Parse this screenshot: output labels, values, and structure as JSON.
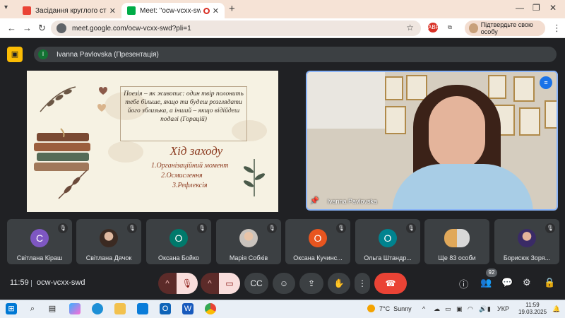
{
  "browser": {
    "tabs": [
      {
        "title": "Засідання круглого столу з ел",
        "active": false
      },
      {
        "title": "Meet: \"ocw-vcxx-swd\"",
        "active": true
      }
    ],
    "new_tab": "+",
    "url": "meet.google.com/ocw-vcxx-swd?pli=1",
    "confirm_label": "Підтвердьте свою особу",
    "ext_label": "ABP"
  },
  "meet": {
    "presenter_initial": "I",
    "presentation_label": "Ivanna Pavlovska (Презентація)",
    "slide": {
      "quote": "Поезія – як живопис: один твір полонить тебе більше, якщо ти будеш розглядати його зблизька, а інший – якщо відійдеш подалі (Горацій)",
      "title": "Хід заходу",
      "items": [
        "1.Організаційний момент",
        "2.Осмислення",
        "3.Рефлексія"
      ]
    },
    "main_video_name": "Ivanna Pavlovska",
    "participants": [
      {
        "name": "Світлана Кіраш",
        "initial": "С",
        "color": "#7e57c2",
        "photo": false
      },
      {
        "name": "Світлана Дячок",
        "initial": "",
        "color": "#8d5a44",
        "photo": true
      },
      {
        "name": "Оксана Бойко",
        "initial": "О",
        "color": "#00796b",
        "photo": false
      },
      {
        "name": "Марія Собків",
        "initial": "",
        "color": "#b0a29a",
        "photo": true
      },
      {
        "name": "Оксана Кучинс...",
        "initial": "О",
        "color": "#e8551f",
        "photo": false
      },
      {
        "name": "Ольга Штандр...",
        "initial": "О",
        "color": "#00838f",
        "photo": false
      },
      {
        "name": "Ще 83 особи",
        "initial": "",
        "color": "#3c4043",
        "photo": false
      },
      {
        "name": "Борисюк Зоря...",
        "initial": "",
        "color": "#6d4c41",
        "photo": true
      }
    ],
    "time": "11:59",
    "meeting_code": "ocw-vcxx-swd",
    "people_count": "92"
  },
  "taskbar": {
    "weather_temp": "7°C",
    "weather_text": "Sunny",
    "lang": "УКР",
    "time": "11:59",
    "date": "19.03.2025"
  }
}
